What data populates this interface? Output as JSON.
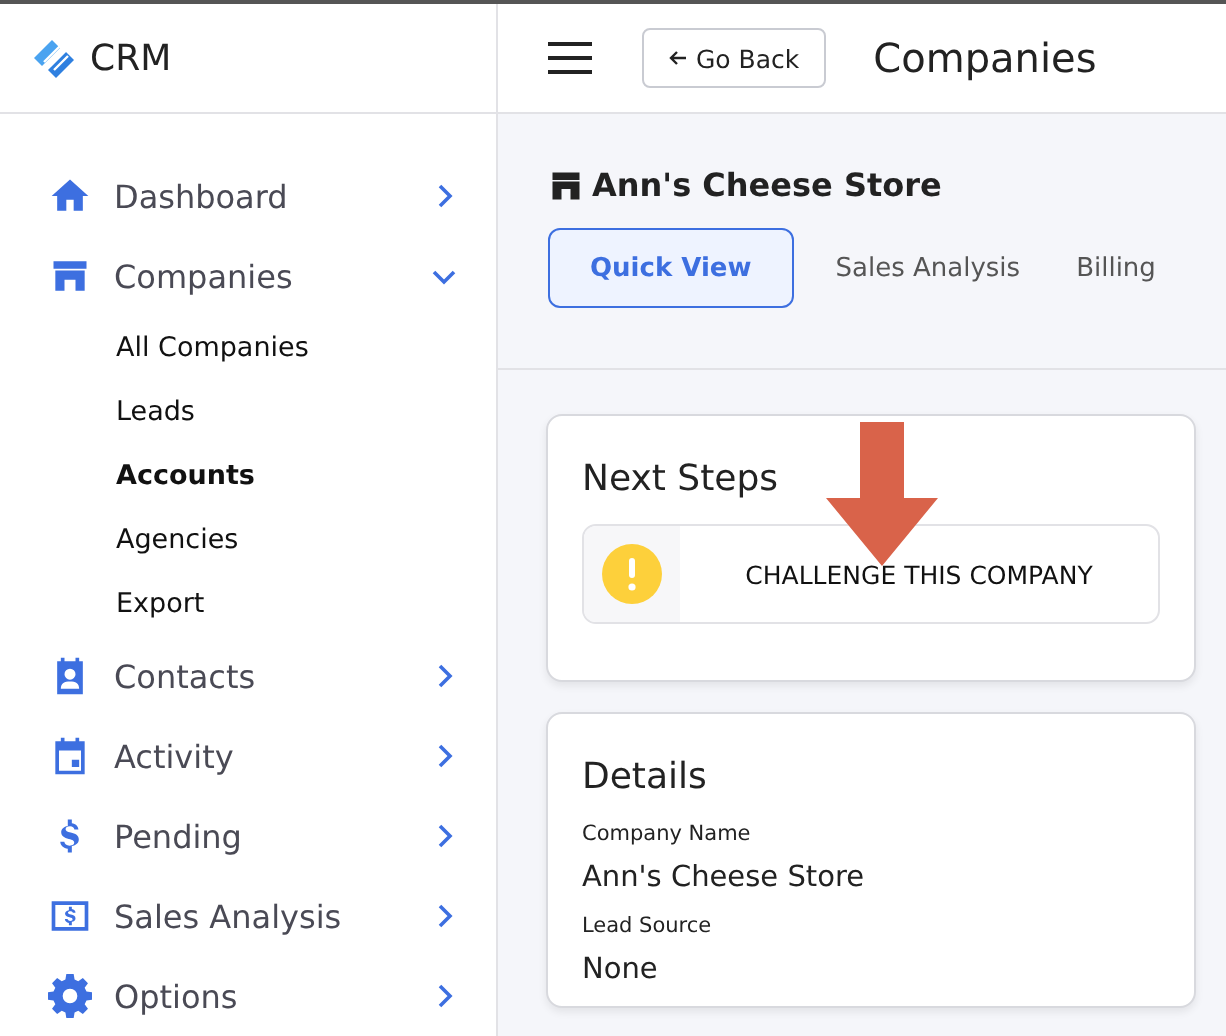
{
  "brand": {
    "name": "CRM"
  },
  "sidebar": {
    "items": [
      {
        "kind": "top",
        "label": "Dashboard",
        "expanded": false
      },
      {
        "kind": "top",
        "label": "Companies",
        "expanded": true,
        "children": [
          {
            "label": "All Companies",
            "selected": false
          },
          {
            "label": "Leads",
            "selected": false
          },
          {
            "label": "Accounts",
            "selected": true
          },
          {
            "label": "Agencies",
            "selected": false
          },
          {
            "label": "Export",
            "selected": false
          }
        ]
      },
      {
        "kind": "top",
        "label": "Contacts",
        "expanded": false
      },
      {
        "kind": "top",
        "label": "Activity",
        "expanded": false
      },
      {
        "kind": "top",
        "label": "Pending",
        "expanded": false
      },
      {
        "kind": "top",
        "label": "Sales Analysis",
        "expanded": false
      },
      {
        "kind": "top",
        "label": "Options",
        "expanded": false
      }
    ]
  },
  "topbar": {
    "back_button": "Go Back",
    "title": "Companies"
  },
  "company": {
    "name": "Ann's Cheese Store"
  },
  "tabs": [
    {
      "label": "Quick View",
      "selected": true
    },
    {
      "label": "Sales Analysis",
      "selected": false
    },
    {
      "label": "Billing",
      "selected": false
    }
  ],
  "next_steps": {
    "title": "Next Steps",
    "actions": [
      {
        "label": "CHALLENGE THIS COMPANY"
      }
    ]
  },
  "details": {
    "title": "Details",
    "fields": [
      {
        "label": "Company Name",
        "value": "Ann's Cheese Store"
      },
      {
        "label": "Lead Source",
        "value": "None"
      }
    ]
  }
}
